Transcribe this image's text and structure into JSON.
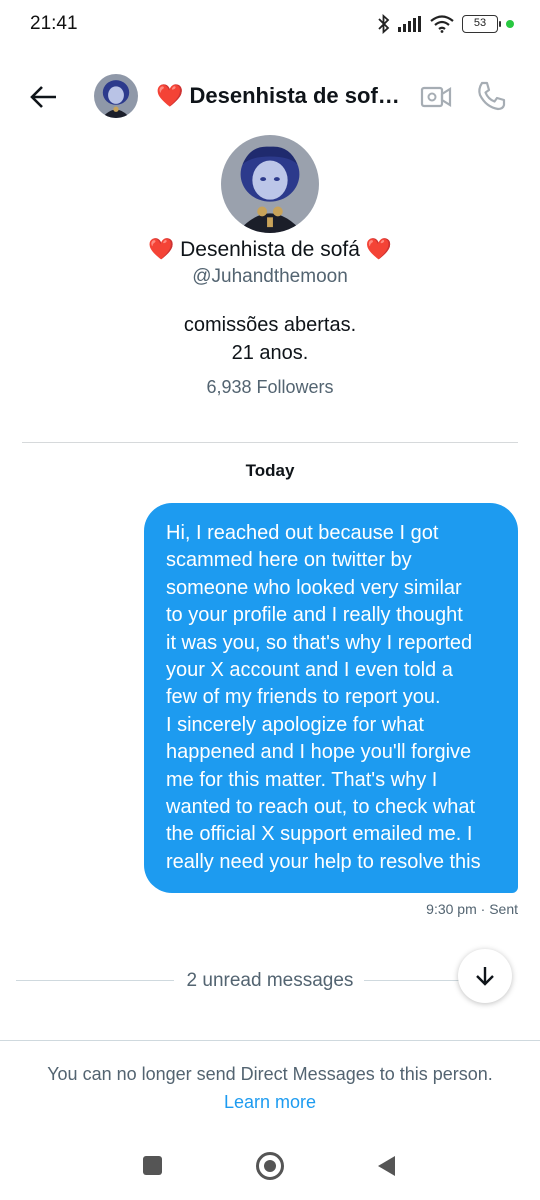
{
  "status_bar": {
    "time": "21:41",
    "battery": "53",
    "icons": [
      "bluetooth-icon",
      "signal-icon",
      "wifi-icon",
      "battery-icon"
    ]
  },
  "header": {
    "title": "❤️ Desenhista de sofá ❤️",
    "icons": [
      "back-arrow-icon",
      "video-call-icon",
      "phone-icon"
    ]
  },
  "profile": {
    "name": "❤️ Desenhista de sofá ❤️",
    "handle": "@Juhandthemoon",
    "bio_lines": [
      "comissões abertas.",
      "21 anos."
    ],
    "followers": "6,938 Followers"
  },
  "conversation": {
    "day_label": "Today",
    "message": {
      "lines": [
        "Hi, I reached out because I got",
        "scammed here on twitter by",
        "someone who looked very similar",
        "to your profile and I really thought",
        "it was you, so that's why I reported",
        "your X account and I even told a",
        "few of my friends to report you.",
        "I sincerely apologize for what",
        "happened and I hope you'll forgive",
        "me for this matter. That's why I",
        "wanted to reach out, to check what",
        "the official X support emailed me. I",
        "really need your help to resolve this"
      ],
      "meta": "9:30 pm · Sent"
    },
    "unread_label": "2 unread messages"
  },
  "footer": {
    "notice": "You can no longer send Direct Messages to this person.",
    "link": "Learn more"
  },
  "colors": {
    "accent": "#1d9bf0",
    "bubble_text": "#ffffff",
    "secondary_text": "#536471",
    "primary_text": "#0f1419"
  }
}
